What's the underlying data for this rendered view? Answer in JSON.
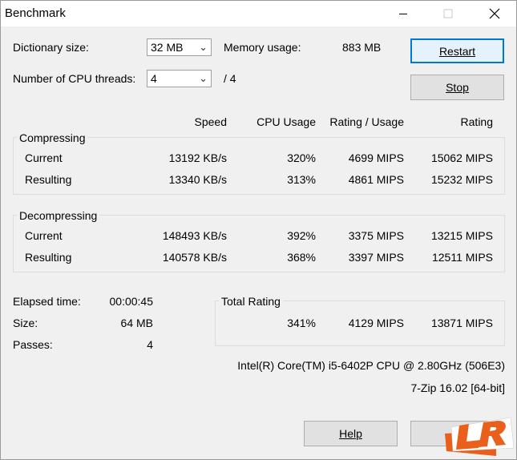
{
  "window": {
    "title": "Benchmark"
  },
  "titlebar": {
    "minimize_icon": "minimize-icon",
    "maximize_icon": "maximize-icon",
    "close_icon": "close-icon"
  },
  "settings": {
    "dictionary_label": "Dictionary size:",
    "dictionary_value": "32 MB",
    "threads_label": "Number of CPU threads:",
    "threads_value": "4",
    "threads_total": "/ 4",
    "memory_label": "Memory usage:",
    "memory_value": "883 MB"
  },
  "buttons": {
    "restart": "Restart",
    "stop": "Stop",
    "help": "Help"
  },
  "columns": {
    "speed": "Speed",
    "cpu_usage": "CPU Usage",
    "rating_usage": "Rating / Usage",
    "rating": "Rating"
  },
  "compressing": {
    "title": "Compressing",
    "rows": [
      {
        "label": "Current",
        "speed": "13192 KB/s",
        "cpu": "320%",
        "rating_usage": "4699 MIPS",
        "rating": "15062 MIPS"
      },
      {
        "label": "Resulting",
        "speed": "13340 KB/s",
        "cpu": "313%",
        "rating_usage": "4861 MIPS",
        "rating": "15232 MIPS"
      }
    ]
  },
  "decompressing": {
    "title": "Decompressing",
    "rows": [
      {
        "label": "Current",
        "speed": "148493 KB/s",
        "cpu": "392%",
        "rating_usage": "3375 MIPS",
        "rating": "13215 MIPS"
      },
      {
        "label": "Resulting",
        "speed": "140578 KB/s",
        "cpu": "368%",
        "rating_usage": "3397 MIPS",
        "rating": "12511 MIPS"
      }
    ]
  },
  "stats": {
    "elapsed_label": "Elapsed time:",
    "elapsed_value": "00:00:45",
    "size_label": "Size:",
    "size_value": "64 MB",
    "passes_label": "Passes:",
    "passes_value": "4"
  },
  "total": {
    "title": "Total Rating",
    "cpu": "341%",
    "rating_usage": "4129 MIPS",
    "rating": "13871 MIPS"
  },
  "info": {
    "cpu": "Intel(R) Core(TM) i5-6402P CPU @ 2.80GHz (506E3)",
    "version": "7-Zip 16.02 [64-bit]"
  },
  "watermark": {
    "text": "Legit Reviews",
    "color": "#e8601c"
  }
}
